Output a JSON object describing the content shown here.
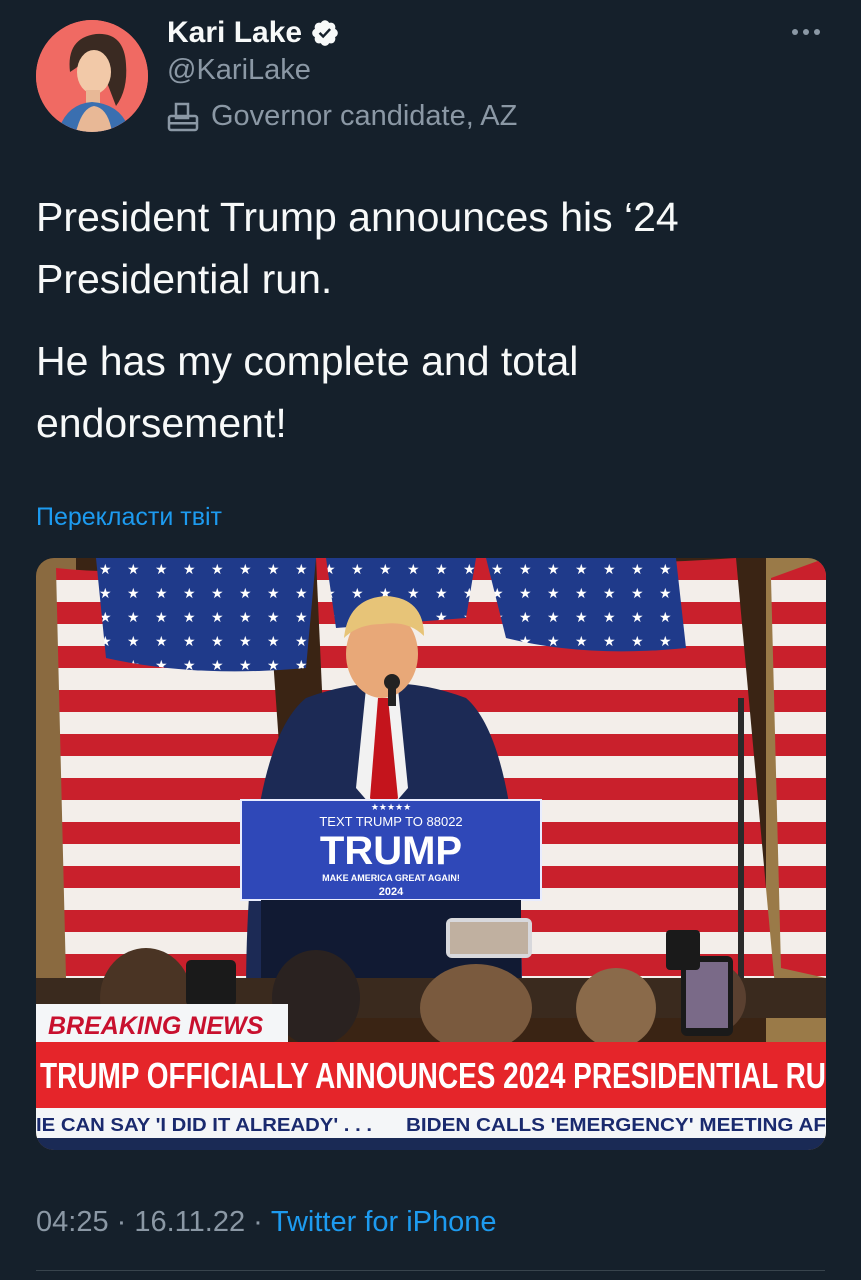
{
  "author": {
    "name": "Kari Lake",
    "handle": "@KariLake",
    "label": "Governor candidate, AZ",
    "verified_icon": "verified-badge-icon",
    "label_icon": "ballot-box-icon"
  },
  "more_icon": "more-options-icon",
  "tweet": {
    "paragraphs": [
      "President Trump announces his ‘24 Presidential run.",
      "He has my complete and total endorsement!"
    ],
    "translate_link": "Перекласти твіт"
  },
  "media": {
    "podium_top": "TEXT TRUMP TO 88022",
    "podium_main": "TRUMP",
    "podium_slogan": "MAKE AMERICA GREAT AGAIN!",
    "podium_year": "2024",
    "podium_stars": "★★★★★",
    "breaking_label": "BREAKING NEWS",
    "headline": "TRUMP OFFICIALLY ANNOUNCES 2024 PRESIDENTIAL RU",
    "ticker_left": "IE CAN SAY 'I DID IT ALREADY' . . .",
    "ticker_right": "BIDEN CALLS 'EMERGENCY' MEETING AF"
  },
  "meta": {
    "time": "04:25",
    "separator": " · ",
    "date": "16.11.22",
    "source": "Twitter for iPhone"
  },
  "colors": {
    "background": "#15202b",
    "accent": "#1d9bf0",
    "secondary_text": "#8b98a5",
    "banner_red": "#e5252a",
    "podium_blue": "#2f48b8"
  }
}
